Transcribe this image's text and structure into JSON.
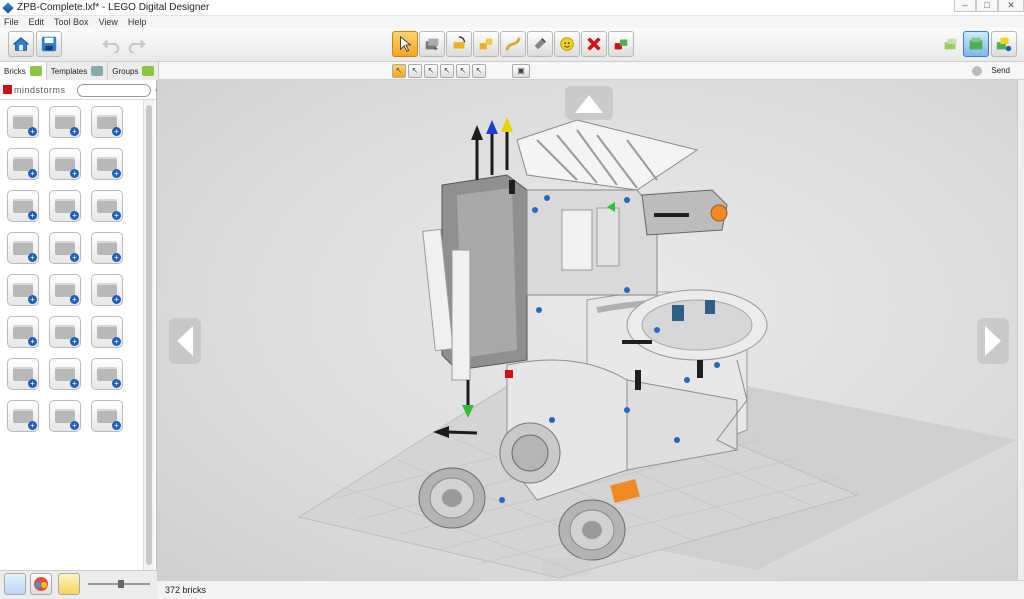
{
  "window": {
    "title": "ZPB-Complete.lxf* - LEGO Digital Designer",
    "controls": [
      "–",
      "□",
      "✕"
    ]
  },
  "menu": [
    "File",
    "Edit",
    "Tool Box",
    "View",
    "Help"
  ],
  "toolbar": {
    "left_buttons": [
      "home-icon",
      "save-icon",
      "undo-icon",
      "redo-icon"
    ],
    "tools": [
      "select-arrow-icon",
      "clone-icon",
      "hinge-icon",
      "hinge-align-icon",
      "flex-icon",
      "paint-icon",
      "decorate-icon",
      "delete-icon",
      "hide-icon"
    ],
    "modes": [
      "build-mode-icon",
      "view-mode-icon",
      "building-guide-icon"
    ]
  },
  "subbar": {
    "tabs": [
      "Bricks",
      "Templates",
      "Groups"
    ],
    "selection_tools": [
      "single-select-icon",
      "connected-select-icon",
      "same-color-select-icon",
      "same-shape-select-icon",
      "same-brick-select-icon",
      "invert-select-icon"
    ],
    "send_label": "Send"
  },
  "palette": {
    "brand": "mindstorms",
    "search_placeholder": "",
    "brick_count": 24
  },
  "status": {
    "bricks": "372 bricks"
  },
  "colors": {
    "active_tool": "#f2a524",
    "lego_red": "#d01012",
    "accent_blue": "#1d5fb3",
    "orange_part": "#f08a24"
  }
}
